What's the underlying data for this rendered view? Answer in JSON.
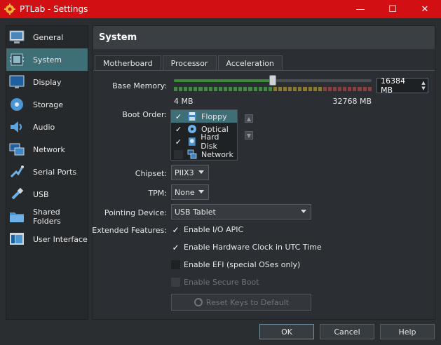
{
  "window": {
    "title": "PTLab - Settings",
    "minimize": "—",
    "maximize": "☐",
    "close": "✕"
  },
  "sidebar": {
    "items": [
      {
        "label": "General",
        "icon": "general-icon",
        "active": false
      },
      {
        "label": "System",
        "icon": "system-icon",
        "active": true
      },
      {
        "label": "Display",
        "icon": "display-icon",
        "active": false
      },
      {
        "label": "Storage",
        "icon": "storage-icon",
        "active": false
      },
      {
        "label": "Audio",
        "icon": "audio-icon",
        "active": false
      },
      {
        "label": "Network",
        "icon": "network-icon",
        "active": false
      },
      {
        "label": "Serial Ports",
        "icon": "serial-ports-icon",
        "active": false
      },
      {
        "label": "USB",
        "icon": "usb-icon",
        "active": false
      },
      {
        "label": "Shared Folders",
        "icon": "shared-folders-icon",
        "active": false
      },
      {
        "label": "User Interface",
        "icon": "user-interface-icon",
        "active": false
      }
    ]
  },
  "content": {
    "header": "System",
    "tabs": [
      {
        "label": "Motherboard",
        "active": true
      },
      {
        "label": "Processor",
        "active": false
      },
      {
        "label": "Acceleration",
        "active": false
      }
    ]
  },
  "motherboard": {
    "base_memory_label": "Base Memory:",
    "memory_value": "16384 MB",
    "memory_min": "4 MB",
    "memory_max": "32768 MB",
    "memory_fraction": 0.5,
    "boot_order_label": "Boot Order:",
    "boot_items": [
      {
        "label": "Floppy",
        "checked": true,
        "selected": true,
        "icon": "floppy-icon"
      },
      {
        "label": "Optical",
        "checked": true,
        "selected": false,
        "icon": "optical-icon"
      },
      {
        "label": "Hard Disk",
        "checked": true,
        "selected": false,
        "icon": "hard-disk-icon"
      },
      {
        "label": "Network",
        "checked": false,
        "selected": false,
        "icon": "network-boot-icon"
      }
    ],
    "chipset_label": "Chipset:",
    "chipset_value": "PIIX3",
    "tpm_label": "TPM:",
    "tpm_value": "None",
    "pointing_label": "Pointing Device:",
    "pointing_value": "USB Tablet",
    "extended_label": "Extended Features:",
    "features": [
      {
        "label": "Enable I/O APIC",
        "checked": true,
        "disabled": false
      },
      {
        "label": "Enable Hardware Clock in UTC Time",
        "checked": true,
        "disabled": false
      },
      {
        "label": "Enable EFI (special OSes only)",
        "checked": false,
        "disabled": false
      },
      {
        "label": "Enable Secure Boot",
        "checked": false,
        "disabled": true
      }
    ],
    "reset_keys": "Reset Keys to Default"
  },
  "buttons": {
    "ok": "OK",
    "cancel": "Cancel",
    "help": "Help"
  },
  "colors": {
    "titlebar": "#d20f12",
    "selection": "#3e6f76"
  }
}
